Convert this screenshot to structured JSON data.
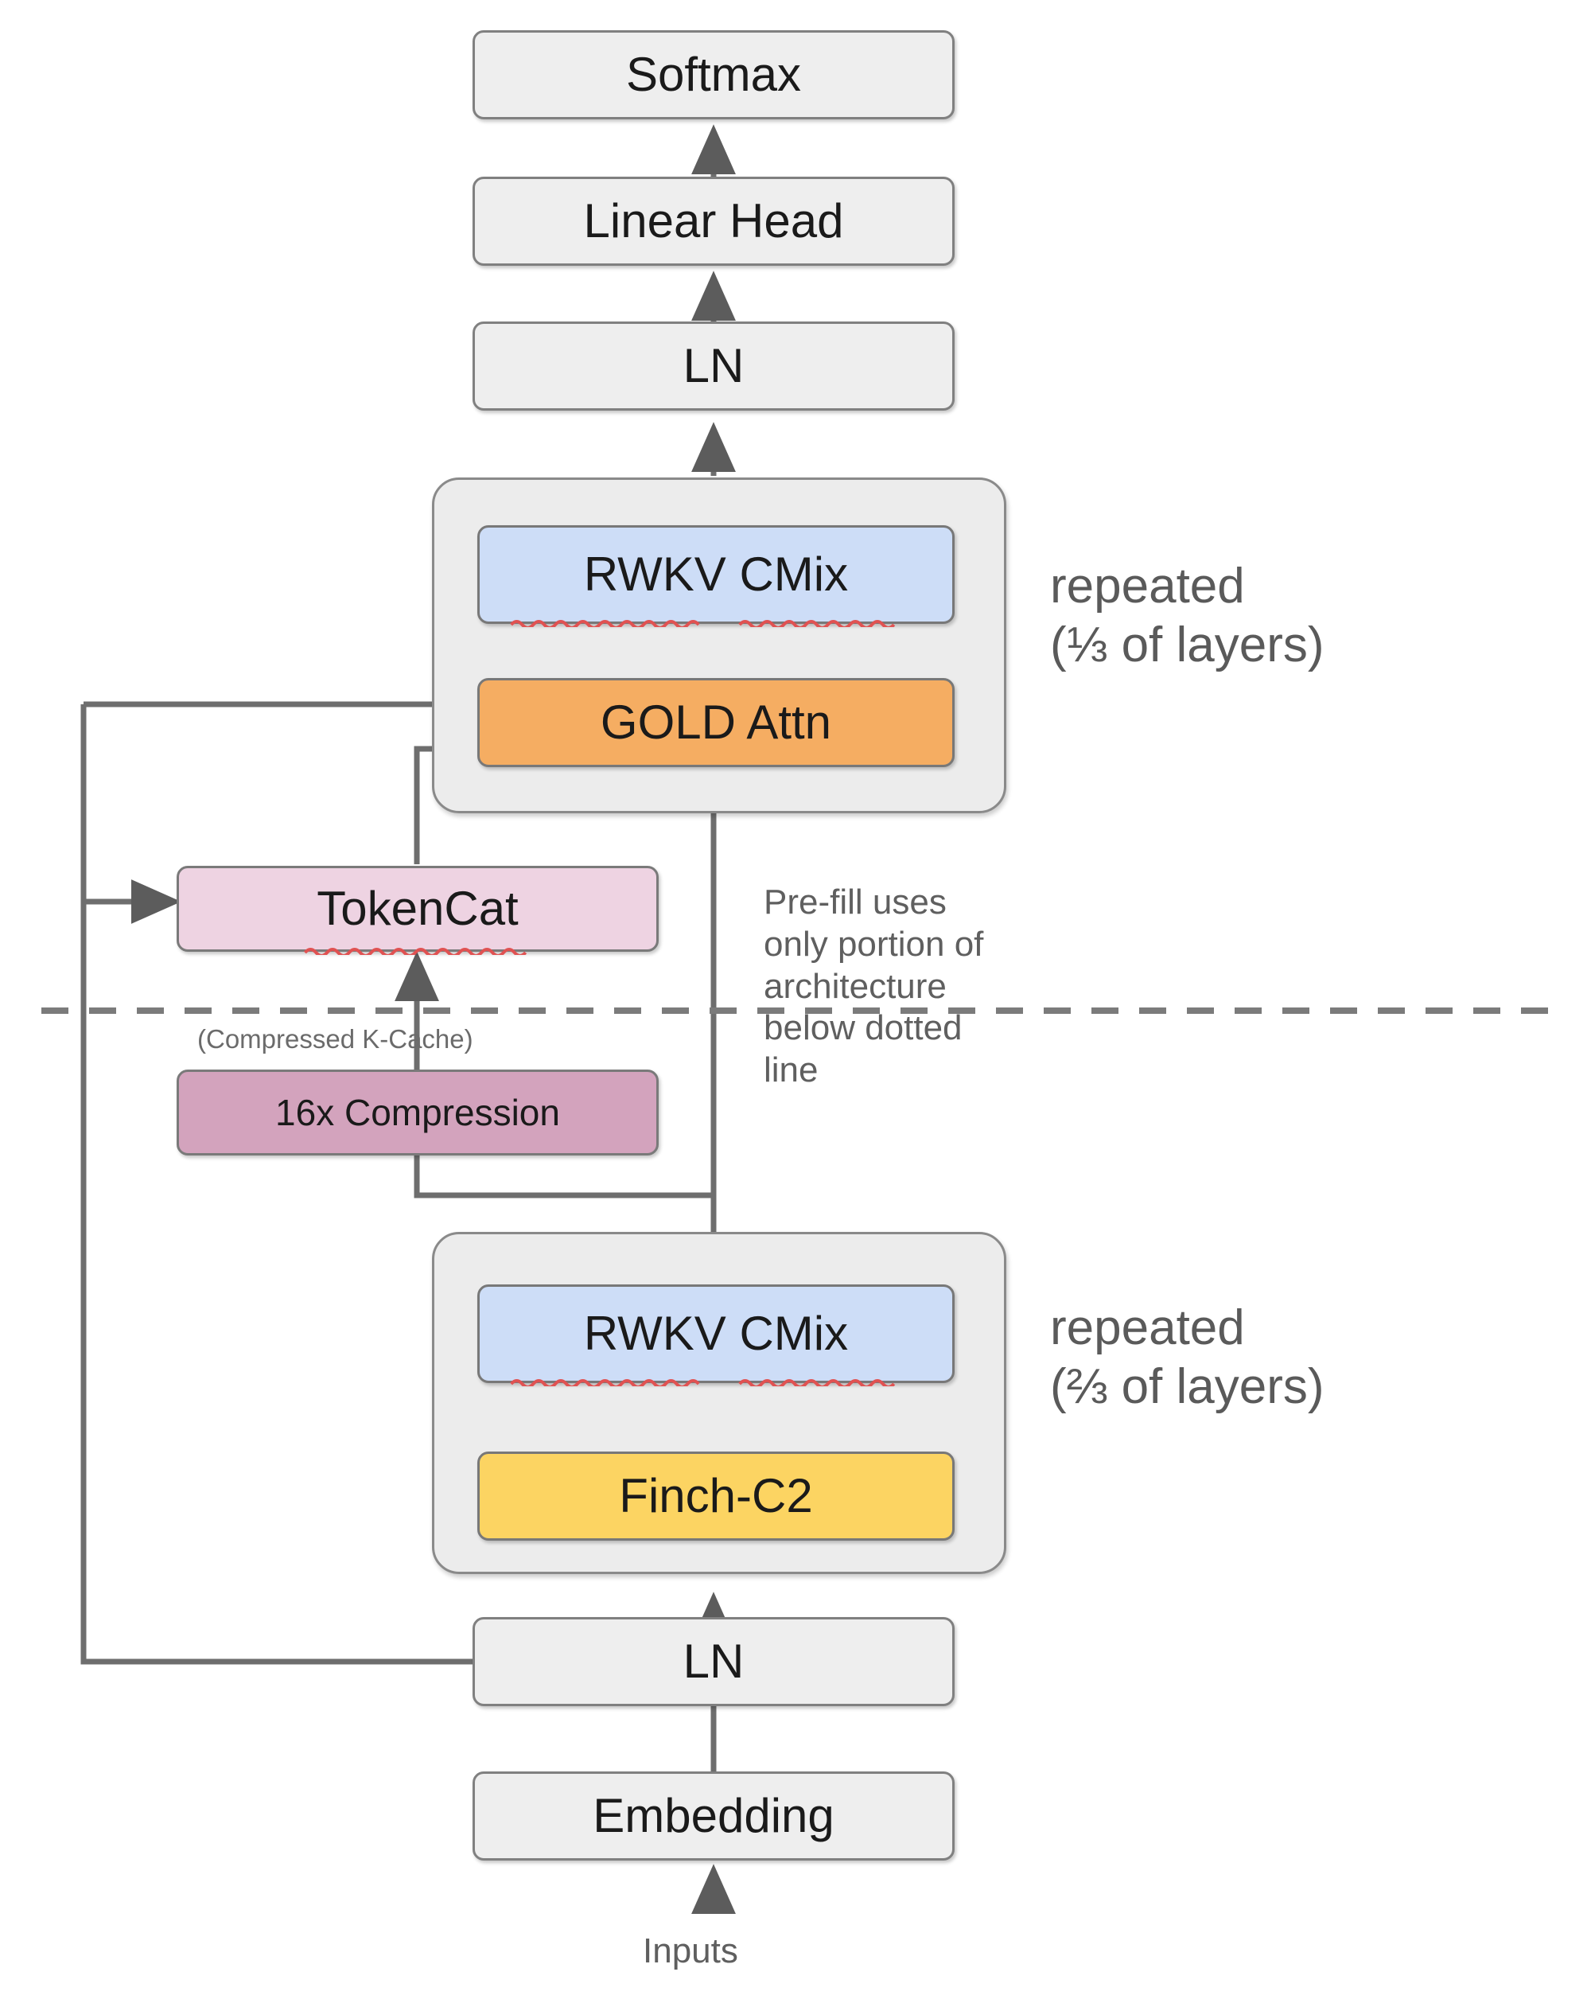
{
  "diagram": {
    "title": "Hybrid RWKV / GOLD attention language-model architecture",
    "colors": {
      "plain": "#eeeeee",
      "group": "#ececec",
      "blue": "#cdddf7",
      "orange": "#f5ad62",
      "yellow": "#fcd462",
      "pink_light": "#eed3e2",
      "pink_dark": "#d3a3bd",
      "stroke": "#7f7f7f",
      "text": "#1a1a1a",
      "annotation": "#5f5f5f",
      "squiggle": "#e05252"
    }
  },
  "nodes": {
    "softmax": "Softmax",
    "linear_head": "Linear Head",
    "ln_top": "LN",
    "rwkv_cmix_top": "RWKV CMix",
    "gold_attn": "GOLD Attn",
    "token_cat": "TokenCat",
    "compression": "16x Compression",
    "rwkv_cmix_bottom": "RWKV CMix",
    "finch_c2": "Finch-C2",
    "ln_bottom": "LN",
    "embedding": "Embedding"
  },
  "annotations": {
    "repeat_top_line1": "repeated",
    "repeat_top_line2": "(⅓ of layers)",
    "repeat_bottom_line1": "repeated",
    "repeat_bottom_line2": "(⅔ of layers)",
    "prefill_note": "Pre-fill uses\nonly portion of\narchitecture\nbelow dotted\nline",
    "k_cache": "(Compressed K-Cache)",
    "inputs": "Inputs"
  }
}
